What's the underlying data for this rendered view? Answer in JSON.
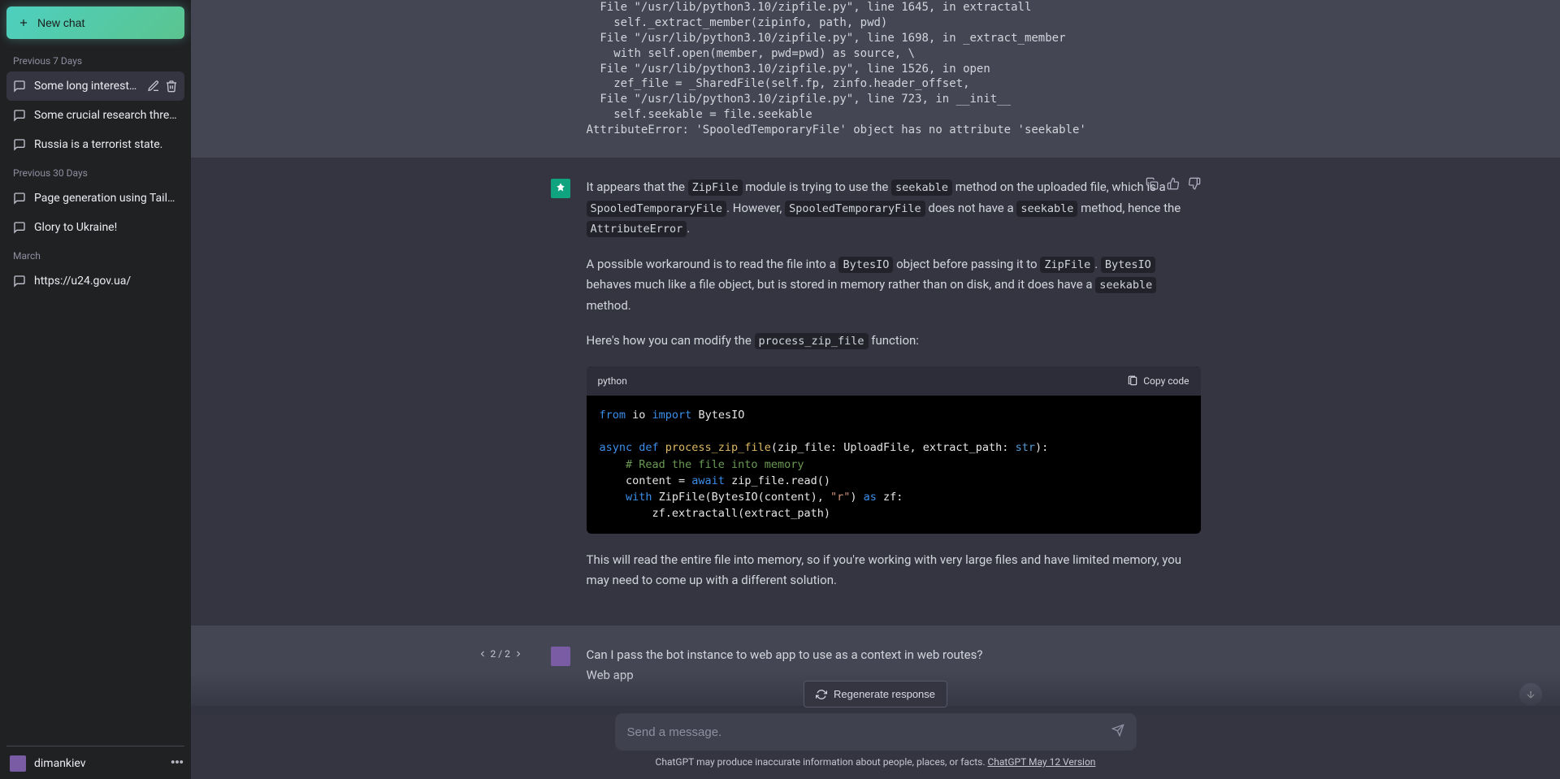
{
  "sidebar": {
    "new_chat_label": "New chat",
    "sections": [
      {
        "title": "Previous 7 Days",
        "items": [
          {
            "label": "Some long interesting thread",
            "active": true
          },
          {
            "label": "Some crucial research thread."
          },
          {
            "label": "Russia is a terrorist state."
          }
        ]
      },
      {
        "title": "Previous 30 Days",
        "items": [
          {
            "label": "Page generation using Tailwind CSS"
          },
          {
            "label": "Glory to Ukraine!"
          }
        ]
      },
      {
        "title": "March",
        "items": [
          {
            "label": "https://u24.gov.ua/"
          }
        ]
      }
    ],
    "user_name": "dimankiev"
  },
  "conversation": {
    "user_top": {
      "traceback": "  File \"/usr/lib/python3.10/zipfile.py\", line 1645, in extractall\n    self._extract_member(zipinfo, path, pwd)\n  File \"/usr/lib/python3.10/zipfile.py\", line 1698, in _extract_member\n    with self.open(member, pwd=pwd) as source, \\\n  File \"/usr/lib/python3.10/zipfile.py\", line 1526, in open\n    zef_file = _SharedFile(self.fp, zinfo.header_offset,\n  File \"/usr/lib/python3.10/zipfile.py\", line 723, in __init__\n    self.seekable = file.seekable\nAttributeError: 'SpooledTemporaryFile' object has no attribute 'seekable'"
    },
    "assistant": {
      "p1_a": "It appears that the ",
      "p1_c1": "ZipFile",
      "p1_b": " module is trying to use the ",
      "p1_c2": "seekable",
      "p1_c": " method on the uploaded file, which is a ",
      "p1_c3": "SpooledTemporaryFile",
      "p1_d": ". However, ",
      "p1_c4": "SpooledTemporaryFile",
      "p1_e": " does not have a ",
      "p1_c5": "seekable",
      "p1_f": " method, hence the ",
      "p1_c6": "AttributeError",
      "p1_g": ".",
      "p2_a": "A possible workaround is to read the file into a ",
      "p2_c1": "BytesIO",
      "p2_b": " object before passing it to ",
      "p2_c2": "ZipFile",
      "p2_c": ". ",
      "p2_c3": "BytesIO",
      "p2_d": " behaves much like a file object, but is stored in memory rather than on disk, and it does have a ",
      "p2_c4": "seekable",
      "p2_e": " method.",
      "p3_a": "Here's how you can modify the ",
      "p3_c1": "process_zip_file",
      "p3_b": " function:",
      "code_lang": "python",
      "copy_label": "Copy code",
      "code": {
        "l1_kw1": "from",
        "l1_mod": " io ",
        "l1_kw2": "import",
        "l1_rest": " BytesIO",
        "l3_kw1": "async",
        "l3_kw2": " def ",
        "l3_fn": "process_zip_file",
        "l3_sig_a": "(zip_file: UploadFile, extract_path: ",
        "l3_type": "str",
        "l3_sig_b": "):",
        "l4_cmt": "    # Read the file into memory",
        "l5_a": "    content = ",
        "l5_kw": "await",
        "l5_b": " zip_file.read()",
        "l6_kw1": "    with",
        "l6_a": " ZipFile(BytesIO(content), ",
        "l6_str": "\"r\"",
        "l6_b": ") ",
        "l6_kw2": "as",
        "l6_c": " zf:",
        "l7": "        zf.extractall(extract_path)"
      },
      "p4": "This will read the entire file into memory, so if you're working with very large files and have limited memory, you may need to come up with a different solution."
    },
    "user_bottom": {
      "pager": "2 / 2",
      "line1": "Can I pass the bot instance to web app to use as a context in web routes?",
      "line2": "Web app"
    }
  },
  "input": {
    "regen_label": "Regenerate response",
    "placeholder": "Send a message.",
    "footer_a": "ChatGPT may produce inaccurate information about people, places, or facts. ",
    "footer_link": "ChatGPT May 12 Version"
  }
}
